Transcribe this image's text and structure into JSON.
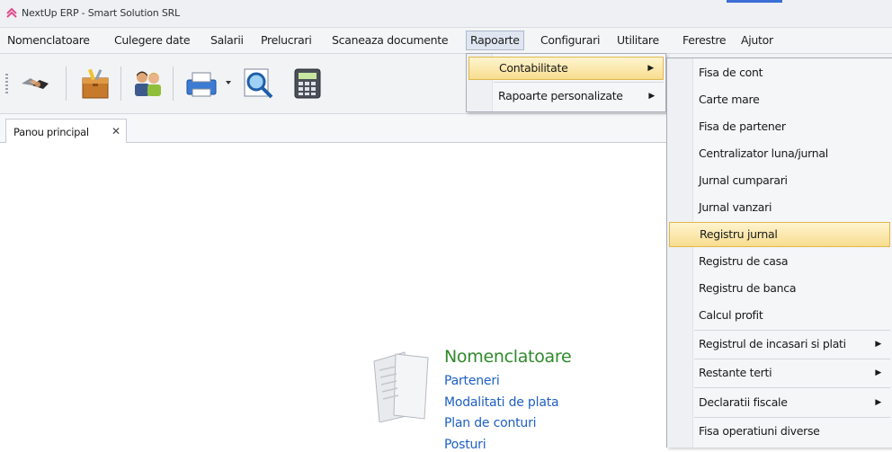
{
  "window": {
    "title": "NextUp ERP - Smart Solution SRL"
  },
  "menubar": {
    "items": [
      {
        "label": "Nomenclatoare"
      },
      {
        "label": "Culegere date"
      },
      {
        "label": "Salarii"
      },
      {
        "label": "Prelucrari"
      },
      {
        "label": "Scaneaza documente"
      },
      {
        "label": "Rapoarte"
      },
      {
        "label": "Configurari"
      },
      {
        "label": "Utilitare"
      },
      {
        "label": "Ferestre"
      },
      {
        "label": "Ajutor"
      }
    ]
  },
  "toolbar": {
    "buttons": [
      "handshake-icon",
      "box-tools-icon",
      "users-icon",
      "printer-icon",
      "search-preview-icon",
      "calculator-icon"
    ]
  },
  "tabs": [
    {
      "label": "Panou principal",
      "close": "✕"
    }
  ],
  "rapoarte_menu": {
    "items": [
      {
        "label": "Contabilitate",
        "submenu": true
      },
      {
        "label": "Rapoarte personalizate",
        "submenu": true
      }
    ]
  },
  "contabilitate_menu": {
    "items": [
      {
        "label": "Fisa de cont"
      },
      {
        "label": "Carte mare"
      },
      {
        "label": "Fisa de partener"
      },
      {
        "label": "Centralizator luna/jurnal"
      },
      {
        "label": "Jurnal cumparari"
      },
      {
        "label": "Jurnal vanzari"
      },
      {
        "label": "Registru jurnal"
      },
      {
        "label": "Registru de casa"
      },
      {
        "label": "Registru de banca"
      },
      {
        "label": "Calcul profit"
      },
      {
        "label": "Registrul de incasari si plati",
        "submenu": true
      },
      {
        "label": "Restante terti",
        "submenu": true
      },
      {
        "label": "Declaratii fiscale",
        "submenu": true
      },
      {
        "label": "Fisa operatiuni diverse"
      }
    ]
  },
  "main_panel": {
    "section_title": "Nomenclatoare",
    "links": [
      "Parteneri",
      "Modalitati de plata",
      "Plan de conturi",
      "Posturi"
    ]
  },
  "colors": {
    "accent_green": "#2f8a2a",
    "link_blue": "#1e5fc2",
    "highlight": "#f7dd8f",
    "logo_pink": "#e04a8c"
  }
}
